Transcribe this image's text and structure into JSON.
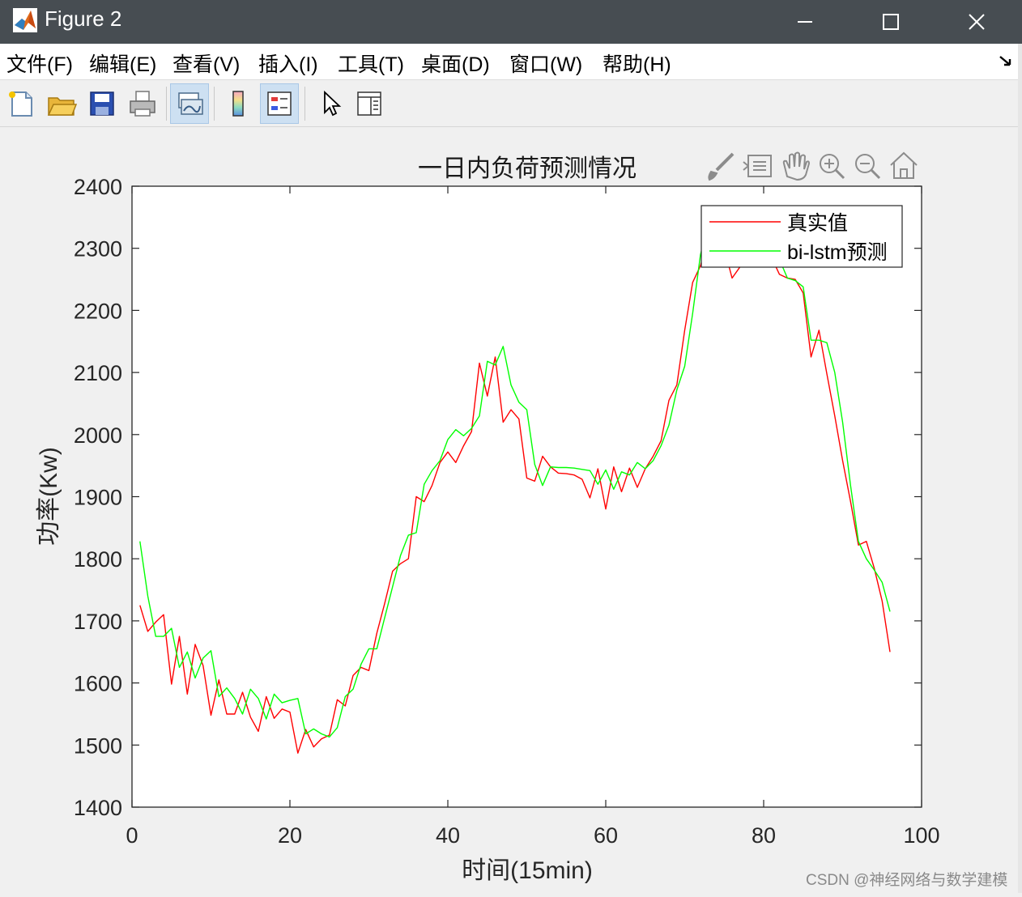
{
  "window": {
    "title": "Figure 2",
    "minimize_glyph": "—",
    "maximize_glyph": "☐",
    "close_glyph": "✕"
  },
  "menu": {
    "items": [
      "文件(F)",
      "编辑(E)",
      "查看(V)",
      "插入(I)",
      "工具(T)",
      "桌面(D)",
      "窗口(W)",
      "帮助(H)"
    ]
  },
  "toolbar": {
    "icons": [
      "new-figure-icon",
      "open-file-icon",
      "save-icon",
      "print-icon",
      "link-plot-icon",
      "colorbar-icon",
      "legend-icon",
      "pointer-icon",
      "property-editor-icon"
    ],
    "axes_toolbar_icons": [
      "brush-icon",
      "data-tip-icon",
      "pan-icon",
      "zoom-in-icon",
      "zoom-out-icon",
      "home-icon"
    ]
  },
  "colors": {
    "titlebar": "#474d52",
    "real_series": "#ff0000",
    "pred_series": "#00ff00",
    "axes_bg": "#ffffff",
    "figure_bg": "#f0f0f0"
  },
  "chart_data": {
    "type": "line",
    "title": "一日内负荷预测情况",
    "xlabel": "时间(15min)",
    "ylabel": "功率(Kw)",
    "xlim": [
      0,
      100
    ],
    "ylim": [
      1400,
      2400
    ],
    "xticks": [
      0,
      20,
      40,
      60,
      80,
      100
    ],
    "yticks": [
      1400,
      1500,
      1600,
      1700,
      1800,
      1900,
      2000,
      2100,
      2200,
      2300,
      2400
    ],
    "grid": false,
    "legend_position": "top-right",
    "x": [
      1,
      2,
      3,
      4,
      5,
      6,
      7,
      8,
      9,
      10,
      11,
      12,
      13,
      14,
      15,
      16,
      17,
      18,
      19,
      20,
      21,
      22,
      23,
      24,
      25,
      26,
      27,
      28,
      29,
      30,
      31,
      32,
      33,
      34,
      35,
      36,
      37,
      38,
      39,
      40,
      41,
      42,
      43,
      44,
      45,
      46,
      47,
      48,
      49,
      50,
      51,
      52,
      53,
      54,
      55,
      56,
      57,
      58,
      59,
      60,
      61,
      62,
      63,
      64,
      65,
      66,
      67,
      68,
      69,
      70,
      71,
      72,
      73,
      74,
      75,
      76,
      77,
      78,
      79,
      80,
      81,
      82,
      83,
      84,
      85,
      86,
      87,
      88,
      89,
      90,
      91,
      92,
      93,
      94,
      95,
      96
    ],
    "series": [
      {
        "name": "真实值",
        "color": "#ff0000",
        "values": [
          1725,
          1683,
          1698,
          1710,
          1598,
          1675,
          1582,
          1662,
          1628,
          1548,
          1605,
          1550,
          1550,
          1585,
          1545,
          1522,
          1578,
          1543,
          1558,
          1553,
          1487,
          1525,
          1497,
          1510,
          1516,
          1573,
          1563,
          1612,
          1625,
          1620,
          1680,
          1728,
          1780,
          1792,
          1800,
          1900,
          1892,
          1918,
          1955,
          1972,
          1955,
          1982,
          2005,
          2115,
          2062,
          2125,
          2020,
          2040,
          2025,
          1930,
          1925,
          1965,
          1948,
          1938,
          1937,
          1935,
          1928,
          1898,
          1945,
          1880,
          1948,
          1908,
          1946,
          1915,
          1945,
          1965,
          1990,
          2055,
          2080,
          2168,
          2245,
          2272,
          2320,
          2345,
          2300,
          2252,
          2270,
          2285,
          2290,
          2300,
          2285,
          2258,
          2252,
          2250,
          2228,
          2125,
          2168,
          2098,
          2030,
          1958,
          1892,
          1822,
          1828,
          1785,
          1732,
          1650
        ]
      },
      {
        "name": "bi-lstm预测",
        "color": "#00ff00",
        "values": [
          1828,
          1740,
          1675,
          1675,
          1688,
          1625,
          1650,
          1608,
          1640,
          1652,
          1578,
          1592,
          1575,
          1550,
          1590,
          1575,
          1542,
          1582,
          1568,
          1572,
          1575,
          1518,
          1526,
          1518,
          1513,
          1528,
          1578,
          1590,
          1630,
          1655,
          1655,
          1705,
          1755,
          1805,
          1838,
          1842,
          1920,
          1942,
          1958,
          1992,
          2008,
          1998,
          2010,
          2030,
          2118,
          2112,
          2142,
          2080,
          2052,
          2040,
          1952,
          1918,
          1948,
          1947,
          1947,
          1946,
          1944,
          1942,
          1920,
          1943,
          1912,
          1940,
          1935,
          1955,
          1945,
          1958,
          1982,
          2015,
          2072,
          2110,
          2195,
          2290,
          2340,
          2355,
          2350,
          2302,
          2280,
          2285,
          2290,
          2300,
          2315,
          2282,
          2252,
          2248,
          2238,
          2152,
          2152,
          2148,
          2100,
          2020,
          1918,
          1828,
          1800,
          1782,
          1762,
          1715
        ]
      }
    ]
  }
}
